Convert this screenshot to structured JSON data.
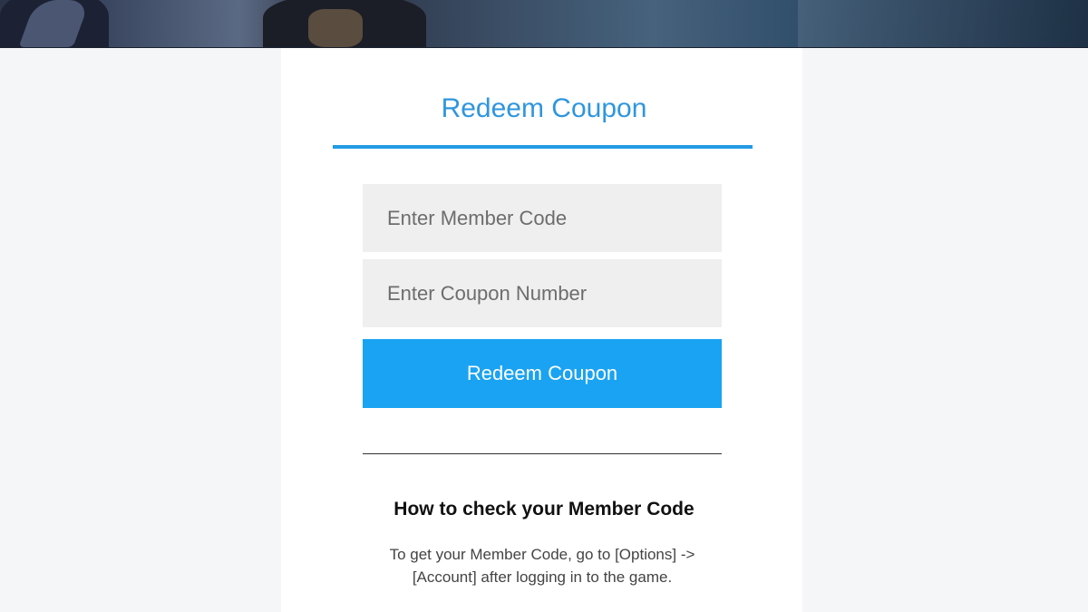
{
  "redeem_form": {
    "title": "Redeem Coupon",
    "member_code": {
      "value": "",
      "placeholder": "Enter Member Code"
    },
    "coupon_number": {
      "value": "",
      "placeholder": "Enter Coupon Number"
    },
    "submit_label": "Redeem Coupon"
  },
  "help": {
    "title": "How to check your Member Code",
    "text": "To get your Member Code, go to [Options] -> [Account] after logging in to the game."
  },
  "colors": {
    "accent": "#2e96df",
    "button": "#1aa3f2",
    "field_background": "#efefef",
    "page_background": "#f5f6f8"
  }
}
